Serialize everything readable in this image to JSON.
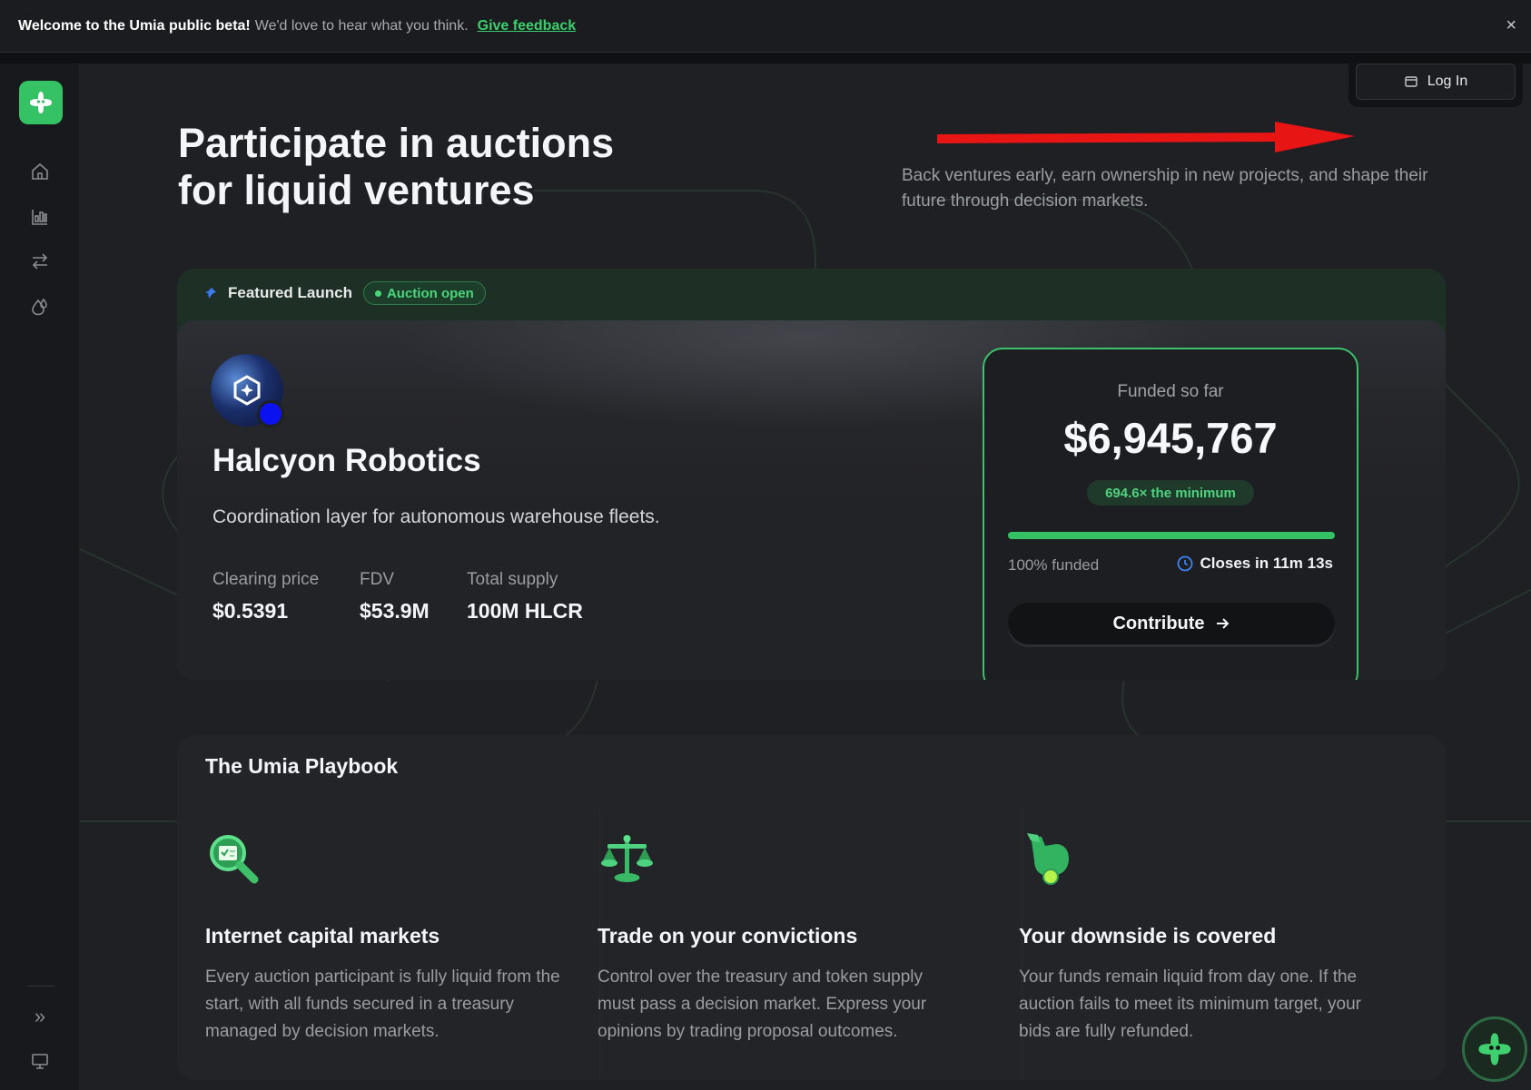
{
  "banner": {
    "welcome": "Welcome to the Umia public beta!",
    "message": "We'd love to hear what you think.",
    "feedback_link": "Give feedback",
    "close_glyph": "×"
  },
  "sidebar": {
    "logo_icon": "umia-logo-icon",
    "items": [
      {
        "icon": "home-icon"
      },
      {
        "icon": "markets-chart-icon"
      },
      {
        "icon": "swap-arrows-icon"
      },
      {
        "icon": "drops-icon"
      }
    ],
    "bottom": [
      {
        "icon": "expand-chevrons-icon",
        "glyph": "»"
      },
      {
        "icon": "monitor-icon"
      }
    ]
  },
  "header": {
    "login_label": "Log In"
  },
  "hero": {
    "title_line1": "Participate in auctions",
    "title_line2": "for liquid ventures",
    "subtitle": "Back ventures early, earn ownership in new projects, and shape their future through decision markets."
  },
  "featured": {
    "label": "Featured Launch",
    "status": "Auction open",
    "project_name": "Halcyon Robotics",
    "description": "Coordination layer for autonomous warehouse fleets.",
    "stats": [
      {
        "label": "Clearing price",
        "value": "$0.5391"
      },
      {
        "label": "FDV",
        "value": "$53.9M"
      },
      {
        "label": "Total supply",
        "value": "100M HLCR"
      }
    ],
    "funding": {
      "label": "Funded so far",
      "amount": "$6,945,767",
      "multiple": "694.6× the minimum",
      "progress_fraction": 1.0,
      "funded_text": "100% funded",
      "closes_text": "Closes in 11m 13s",
      "cta": "Contribute"
    }
  },
  "playbook": {
    "title": "The Umia Playbook",
    "items": [
      {
        "icon": "magnifier-document-icon",
        "title": "Internet capital markets",
        "text": "Every auction participant is fully liquid from the start, with all funds secured in a treasury managed by decision markets."
      },
      {
        "icon": "balance-scale-icon",
        "title": "Trade on your convictions",
        "text": "Control over the treasury and token supply must pass a decision market. Express your opinions by trading proposal outcomes."
      },
      {
        "icon": "pointing-hand-icon",
        "title": "Your downside is covered",
        "text": "Your funds remain liquid from day one. If the auction fails to meet its minimum target, your bids are fully refunded."
      }
    ]
  },
  "colors": {
    "accent": "#34c264",
    "accent_text": "#4bd67b",
    "annotation_arrow": "#e81515",
    "background": "#1f2023"
  }
}
